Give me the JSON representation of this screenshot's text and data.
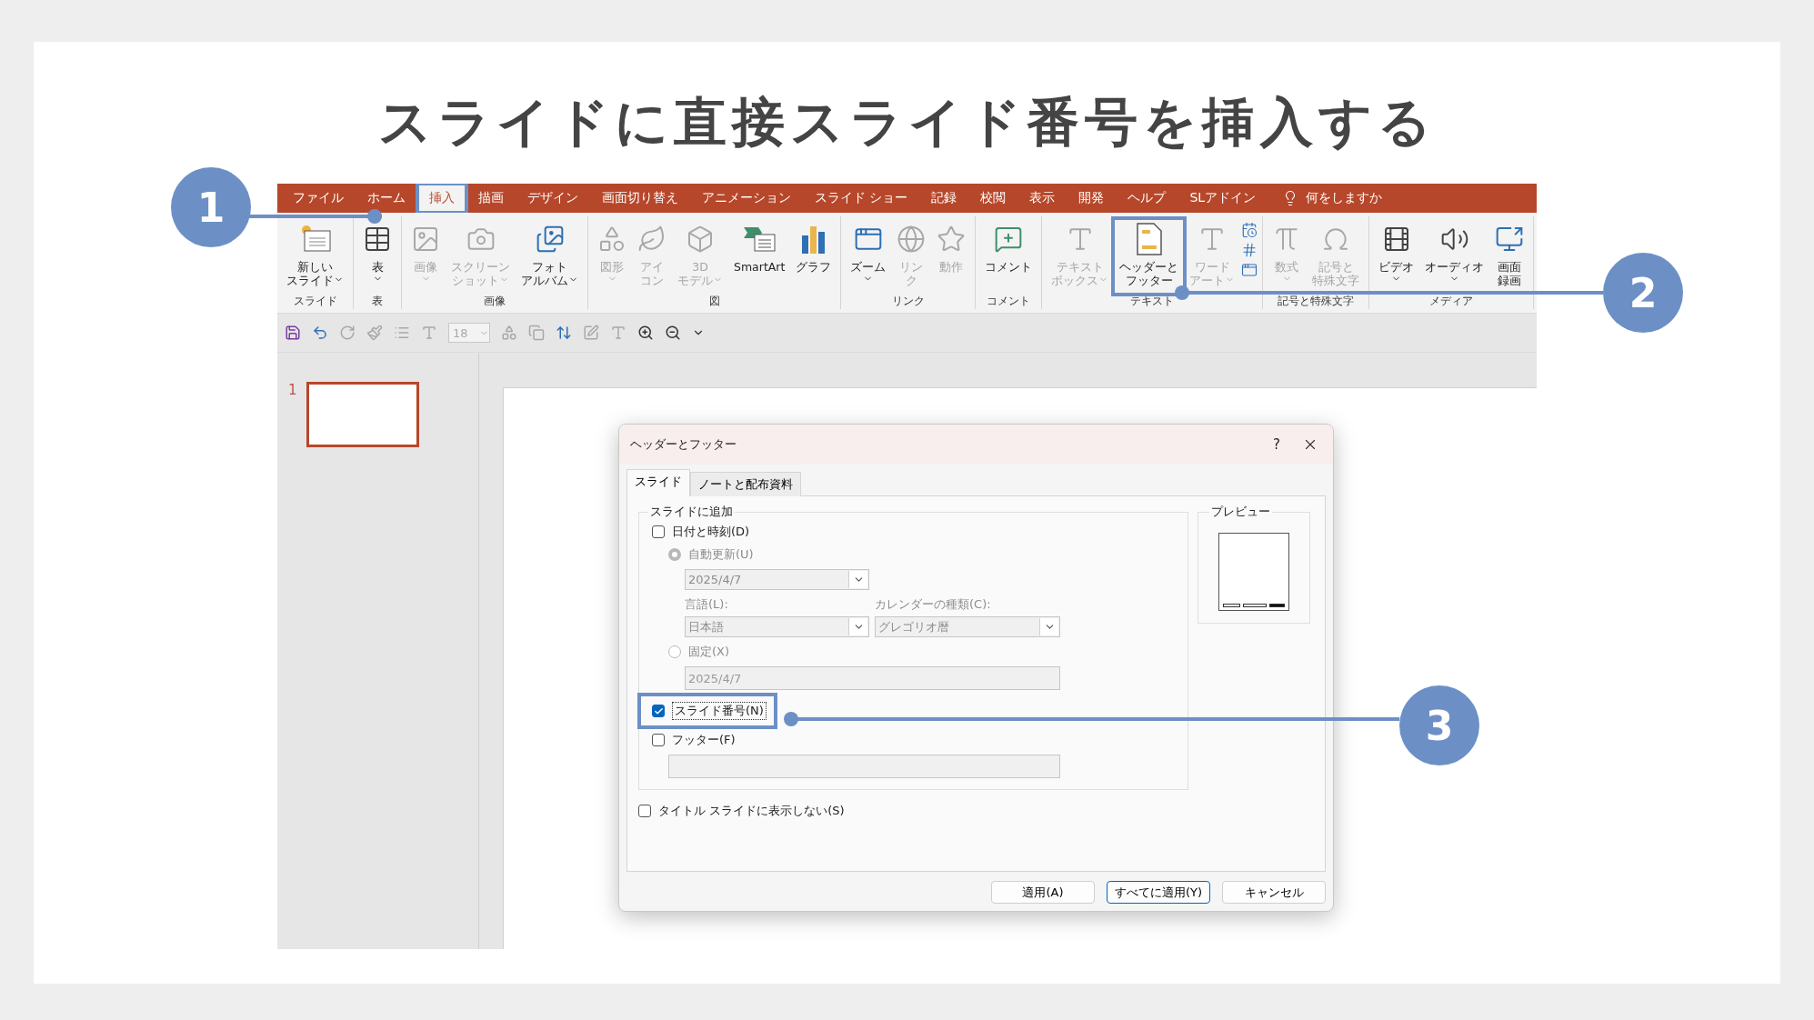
{
  "title": "スライドに直接スライド番号を挿入する",
  "tabs": [
    {
      "label": "ファイル",
      "selected": false,
      "highlighted": false
    },
    {
      "label": "ホーム",
      "selected": false,
      "highlighted": false
    },
    {
      "label": "挿入",
      "selected": true,
      "highlighted": true
    },
    {
      "label": "描画",
      "selected": false,
      "highlighted": false
    },
    {
      "label": "デザイン",
      "selected": false,
      "highlighted": false
    },
    {
      "label": "画面切り替え",
      "selected": false,
      "highlighted": false
    },
    {
      "label": "アニメーション",
      "selected": false,
      "highlighted": false
    },
    {
      "label": "スライド ショー",
      "selected": false,
      "highlighted": false
    },
    {
      "label": "記録",
      "selected": false,
      "highlighted": false
    },
    {
      "label": "校閲",
      "selected": false,
      "highlighted": false
    },
    {
      "label": "表示",
      "selected": false,
      "highlighted": false
    },
    {
      "label": "開発",
      "selected": false,
      "highlighted": false
    },
    {
      "label": "ヘルプ",
      "selected": false,
      "highlighted": false
    },
    {
      "label": "SLアドイン",
      "selected": false,
      "highlighted": false
    }
  ],
  "tell_me": "何をしますか",
  "ribbon_groups": [
    {
      "label": "スライド",
      "buttons": [
        {
          "kind": "large",
          "lines": [
            "新しい",
            "スライド"
          ],
          "disabled": false,
          "dropdown": true,
          "highlighted": false
        }
      ]
    },
    {
      "label": "表",
      "buttons": [
        {
          "kind": "large",
          "lines": [
            "表"
          ],
          "disabled": false,
          "dropdown": true,
          "highlighted": false
        }
      ]
    },
    {
      "label": "画像",
      "buttons": [
        {
          "kind": "large",
          "lines": [
            "画像"
          ],
          "disabled": true,
          "dropdown": true,
          "highlighted": false
        },
        {
          "kind": "large",
          "lines": [
            "スクリーン",
            "ショット"
          ],
          "disabled": true,
          "dropdown": true,
          "highlighted": false
        },
        {
          "kind": "large",
          "lines": [
            "フォト",
            "アルバム"
          ],
          "disabled": false,
          "dropdown": true,
          "highlighted": false
        }
      ]
    },
    {
      "label": "図",
      "buttons": [
        {
          "kind": "large",
          "lines": [
            "図形"
          ],
          "disabled": true,
          "dropdown": true,
          "highlighted": false
        },
        {
          "kind": "large",
          "lines": [
            "アイ",
            "コン"
          ],
          "disabled": true,
          "dropdown": false,
          "highlighted": false
        },
        {
          "kind": "large",
          "lines": [
            "3D",
            "モデル"
          ],
          "disabled": true,
          "dropdown": true,
          "highlighted": false
        },
        {
          "kind": "large",
          "lines": [
            "SmartArt"
          ],
          "disabled": false,
          "dropdown": false,
          "highlighted": false
        },
        {
          "kind": "large",
          "lines": [
            "グラフ"
          ],
          "disabled": false,
          "dropdown": false,
          "highlighted": false
        }
      ]
    },
    {
      "label": "リンク",
      "buttons": [
        {
          "kind": "large",
          "lines": [
            "ズーム"
          ],
          "disabled": false,
          "dropdown": true,
          "highlighted": false
        },
        {
          "kind": "large",
          "lines": [
            "リン",
            "ク"
          ],
          "disabled": true,
          "dropdown": false,
          "highlighted": false
        },
        {
          "kind": "large",
          "lines": [
            "動作"
          ],
          "disabled": true,
          "dropdown": false,
          "highlighted": false
        }
      ]
    },
    {
      "label": "コメント",
      "buttons": [
        {
          "kind": "large",
          "lines": [
            "コメント"
          ],
          "disabled": false,
          "dropdown": false,
          "highlighted": false
        }
      ]
    },
    {
      "label": "テキスト",
      "buttons": [
        {
          "kind": "large",
          "lines": [
            "テキスト",
            "ボックス"
          ],
          "disabled": true,
          "dropdown": true,
          "highlighted": false
        },
        {
          "kind": "large",
          "lines": [
            "ヘッダーと",
            "フッター"
          ],
          "disabled": false,
          "dropdown": false,
          "highlighted": true
        },
        {
          "kind": "large",
          "lines": [
            "ワード",
            "アート"
          ],
          "disabled": true,
          "dropdown": true,
          "highlighted": false
        },
        {
          "kind": "stack"
        }
      ]
    },
    {
      "label": "記号と特殊文字",
      "buttons": [
        {
          "kind": "large",
          "lines": [
            "数式"
          ],
          "disabled": true,
          "dropdown": true,
          "highlighted": false
        },
        {
          "kind": "large",
          "lines": [
            "記号と",
            "特殊文字"
          ],
          "disabled": true,
          "dropdown": false,
          "highlighted": false
        }
      ]
    },
    {
      "label": "メディア",
      "buttons": [
        {
          "kind": "large",
          "lines": [
            "ビデオ"
          ],
          "disabled": false,
          "dropdown": true,
          "highlighted": false
        },
        {
          "kind": "large",
          "lines": [
            "オーディオ"
          ],
          "disabled": false,
          "dropdown": true,
          "highlighted": false
        },
        {
          "kind": "large",
          "lines": [
            "画面",
            "録画"
          ],
          "disabled": false,
          "dropdown": false,
          "highlighted": false
        }
      ]
    }
  ],
  "quick_access": {
    "font_size": "18"
  },
  "slides": [
    {
      "number": "1",
      "selected": true
    }
  ],
  "dialog": {
    "title": "ヘッダーとフッター",
    "help": "?",
    "tabs": [
      {
        "label": "スライド",
        "selected": true
      },
      {
        "label": "ノートと配布資料",
        "selected": false
      }
    ],
    "group_label": "スライドに追加",
    "date_time": {
      "label": "日付と時刻(D)",
      "checked": false
    },
    "auto_update": {
      "label": "自動更新(U)",
      "selected": true
    },
    "auto_date": {
      "value": "2025/4/7"
    },
    "language": {
      "label": "言語(L):",
      "value": "日本語"
    },
    "calendar": {
      "label": "カレンダーの種類(C):",
      "value": "グレゴリオ暦"
    },
    "fixed": {
      "label": "固定(X)",
      "selected": false
    },
    "fixed_date": {
      "value": "2025/4/7"
    },
    "slide_number": {
      "label": "スライド番号(N)",
      "checked": true,
      "highlighted": true
    },
    "footer": {
      "label": "フッター(F)",
      "checked": false
    },
    "hide_on_title": {
      "label": "タイトル スライドに表示しない(S)",
      "checked": false
    },
    "preview_label": "プレビュー",
    "buttons": [
      {
        "label": "適用(A)",
        "default": false
      },
      {
        "label": "すべてに適用(Y)",
        "default": true
      },
      {
        "label": "キャンセル",
        "default": false
      }
    ]
  },
  "callouts": [
    {
      "number": "1"
    },
    {
      "number": "2"
    },
    {
      "number": "3"
    }
  ]
}
